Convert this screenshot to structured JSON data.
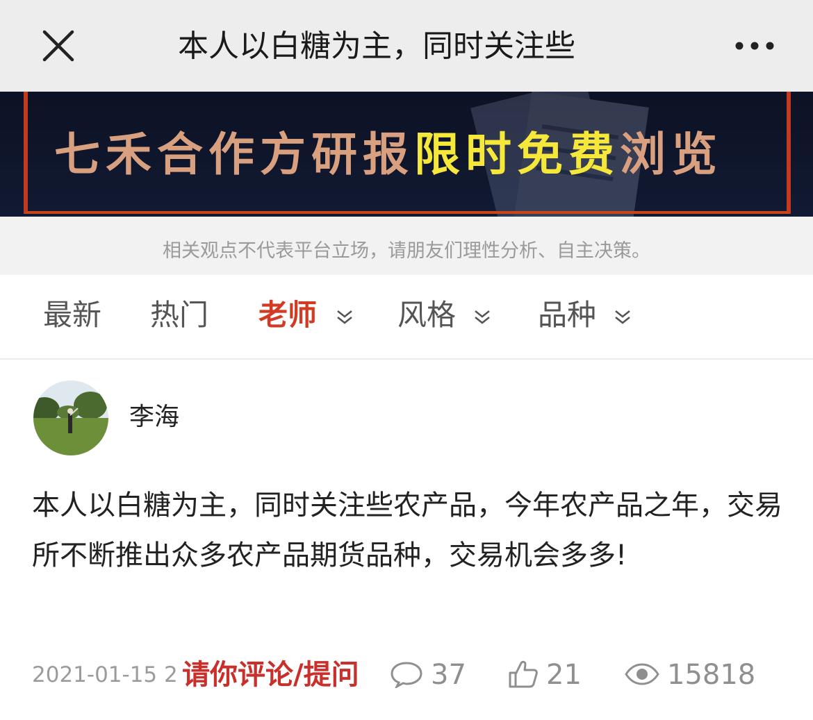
{
  "nav": {
    "close_icon": "close-icon",
    "title": "本人以白糖为主，同时关注些",
    "more_icon": "more-icon"
  },
  "banner": {
    "text_part1": "七禾合作方研报",
    "text_part2": "限时免费",
    "text_part3": "浏览"
  },
  "disclaimer": "相关观点不代表平台立场，请朋友们理性分析、自主决策。",
  "tabs": [
    {
      "label": "最新",
      "active": false
    },
    {
      "label": "热门",
      "active": false
    },
    {
      "label": "老师",
      "active": true,
      "dropdown": true
    },
    {
      "label": "风格",
      "active": false,
      "dropdown": true
    },
    {
      "label": "品种",
      "active": false,
      "dropdown": true
    }
  ],
  "post": {
    "author": "李海",
    "content": "本人以白糖为主，同时关注些农产品，今年农产品之年，交易所不断推出众多农产品期货品种，交易机会多多!",
    "date": "2021-01-15 2",
    "cta": "请你评论/提问",
    "comments": "37",
    "likes": "21",
    "views": "15818"
  },
  "colors": {
    "accent_red": "#d33a24",
    "cta_red": "#c9302c",
    "banner_yellow": "#f5e83a",
    "banner_bg": "#0d1224"
  }
}
